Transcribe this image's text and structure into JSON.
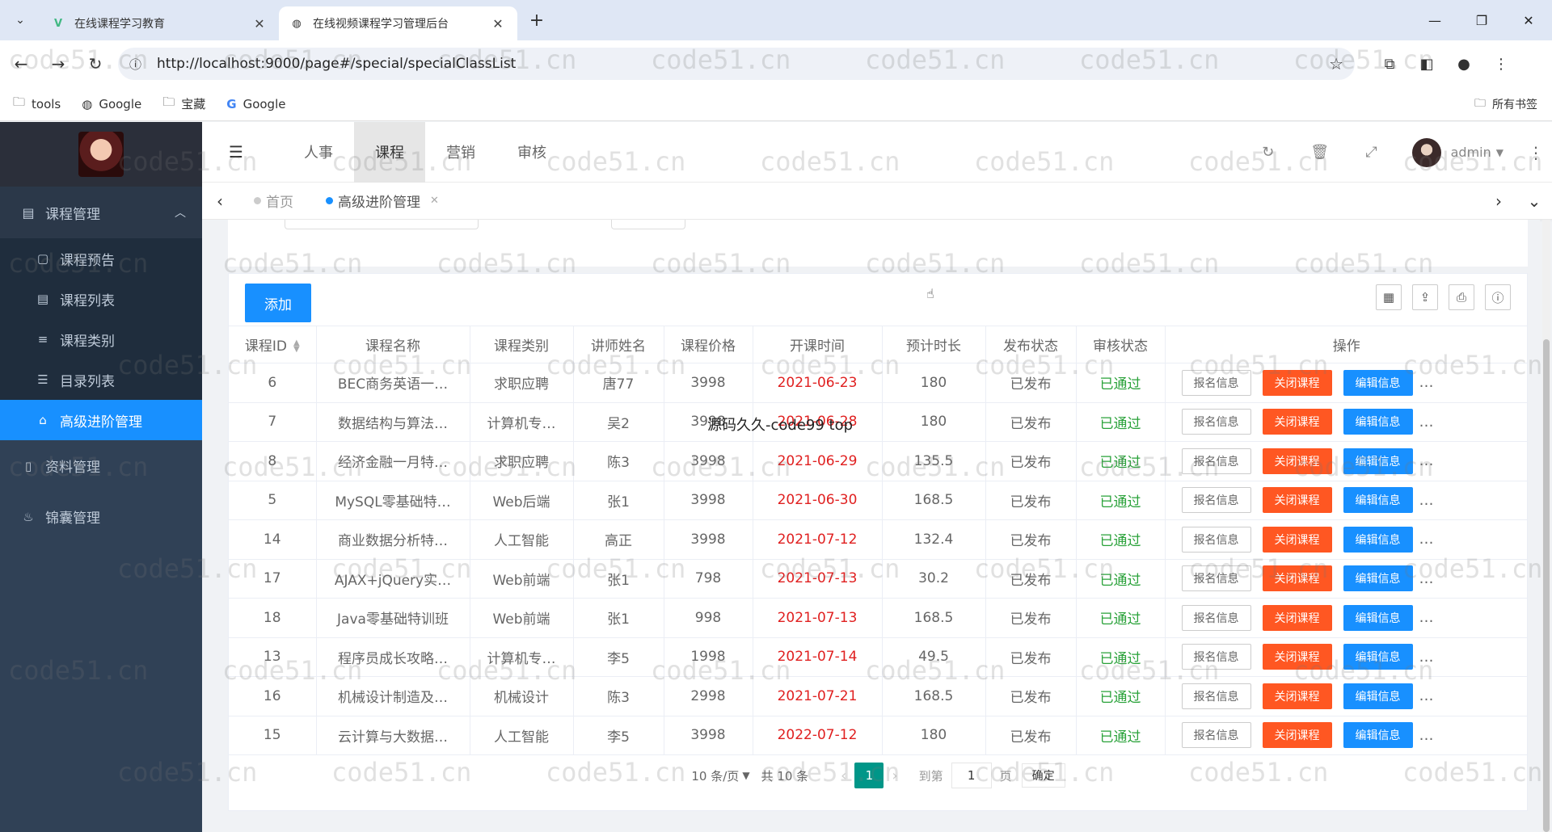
{
  "browser": {
    "tabs": [
      {
        "title": "在线课程学习教育",
        "icon": "vue-icon",
        "active": false
      },
      {
        "title": "在线视频课程学习管理后台",
        "icon": "globe-icon",
        "active": true
      }
    ],
    "url": "http://localhost:9000/page#/special/specialClassList",
    "bookmarks": [
      {
        "label": "tools",
        "icon": "folder-icon"
      },
      {
        "label": "Google",
        "icon": "globe-icon"
      },
      {
        "label": "宝藏",
        "icon": "folder-icon"
      },
      {
        "label": "Google",
        "icon": "google-icon"
      }
    ],
    "all_bookmarks": "所有书签"
  },
  "sidebar": {
    "group_course": "课程管理",
    "sub_items": [
      {
        "label": "课程预告",
        "icon": "preview-icon"
      },
      {
        "label": "课程列表",
        "icon": "list-icon"
      },
      {
        "label": "课程类别",
        "icon": "category-icon"
      },
      {
        "label": "目录列表",
        "icon": "catalog-icon"
      },
      {
        "label": "高级进阶管理",
        "icon": "bank-icon",
        "active": true
      }
    ],
    "items": [
      {
        "label": "资料管理",
        "icon": "document-icon"
      },
      {
        "label": "锦囊管理",
        "icon": "bag-icon"
      }
    ]
  },
  "topnav": {
    "menu": [
      "人事",
      "课程",
      "营销",
      "审核"
    ],
    "active_menu": "课程",
    "user": "admin"
  },
  "tags": {
    "home": "首页",
    "current": "高级进阶管理"
  },
  "toolbar": {
    "add_label": "添加"
  },
  "table": {
    "columns": [
      "课程ID",
      "课程名称",
      "课程类别",
      "讲师姓名",
      "课程价格",
      "开课时间",
      "预计时长",
      "发布状态",
      "审核状态",
      "操作"
    ],
    "rows": [
      {
        "id": "6",
        "name": "BEC商务英语一…",
        "category": "求职应聘",
        "teacher": "唐77",
        "price": "3998",
        "date": "2021-06-23",
        "duration": "180",
        "publish": "已发布",
        "audit": "已通过"
      },
      {
        "id": "7",
        "name": "数据结构与算法…",
        "category": "计算机专…",
        "teacher": "吴2",
        "price": "3998",
        "date": "2021-06-28",
        "duration": "180",
        "publish": "已发布",
        "audit": "已通过"
      },
      {
        "id": "8",
        "name": "经济金融一月特…",
        "category": "求职应聘",
        "teacher": "陈3",
        "price": "3998",
        "date": "2021-06-29",
        "duration": "135.5",
        "publish": "已发布",
        "audit": "已通过"
      },
      {
        "id": "5",
        "name": "MySQL零基础特…",
        "category": "Web后端",
        "teacher": "张1",
        "price": "3998",
        "date": "2021-06-30",
        "duration": "168.5",
        "publish": "已发布",
        "audit": "已通过"
      },
      {
        "id": "14",
        "name": "商业数据分析特…",
        "category": "人工智能",
        "teacher": "高正",
        "price": "3998",
        "date": "2021-07-12",
        "duration": "132.4",
        "publish": "已发布",
        "audit": "已通过"
      },
      {
        "id": "17",
        "name": "AJAX+jQuery实…",
        "category": "Web前端",
        "teacher": "张1",
        "price": "798",
        "date": "2021-07-13",
        "duration": "30.2",
        "publish": "已发布",
        "audit": "已通过"
      },
      {
        "id": "18",
        "name": "Java零基础特训班",
        "category": "Web前端",
        "teacher": "张1",
        "price": "998",
        "date": "2021-07-13",
        "duration": "168.5",
        "publish": "已发布",
        "audit": "已通过"
      },
      {
        "id": "13",
        "name": "程序员成长攻略…",
        "category": "计算机专…",
        "teacher": "李5",
        "price": "1998",
        "date": "2021-07-14",
        "duration": "49.5",
        "publish": "已发布",
        "audit": "已通过"
      },
      {
        "id": "16",
        "name": "机械设计制造及…",
        "category": "机械设计",
        "teacher": "陈3",
        "price": "2998",
        "date": "2021-07-21",
        "duration": "168.5",
        "publish": "已发布",
        "audit": "已通过"
      },
      {
        "id": "15",
        "name": "云计算与大数据…",
        "category": "人工智能",
        "teacher": "李5",
        "price": "3998",
        "date": "2022-07-12",
        "duration": "180",
        "publish": "已发布",
        "audit": "已通过"
      }
    ],
    "ops": {
      "info": "报名信息",
      "close": "关闭课程",
      "edit": "编辑信息",
      "more": "…"
    }
  },
  "pager": {
    "page_size": "10 条/页",
    "total": "共 10 条",
    "current": "1",
    "goto_label": "到第",
    "goto_value": "1",
    "goto_unit": "页",
    "confirm": "确定"
  },
  "overlay_text": "源码久久-code99 top",
  "watermark_text": "code51.cn",
  "colors": {
    "sidebar_bg": "#304156",
    "primary": "#1890ff",
    "danger": "#ff5722",
    "success": "#2aa23a",
    "pager_active": "#009688"
  }
}
